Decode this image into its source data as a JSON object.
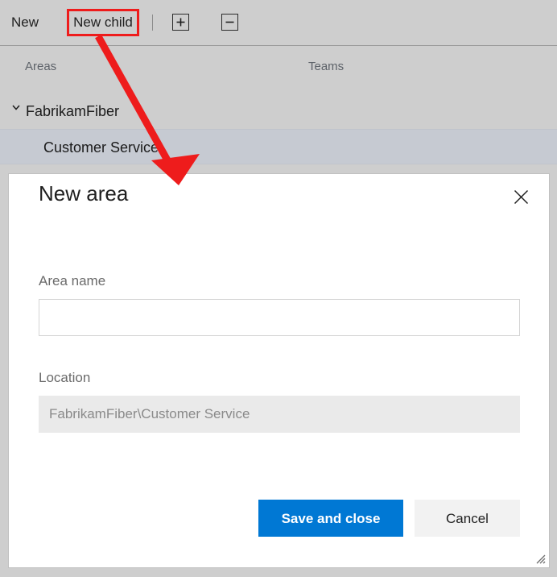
{
  "toolbar": {
    "new_label": "New",
    "new_child_label": "New child",
    "expand_icon": "plus-box-icon",
    "collapse_icon": "minus-box-icon",
    "separator": "|"
  },
  "columns": {
    "areas_label": "Areas",
    "teams_label": "Teams"
  },
  "tree": {
    "rows": [
      {
        "label": "FabrikamFiber",
        "level": 0,
        "expanded": true,
        "selected": false,
        "chevron_icon": "chevron-down-icon"
      },
      {
        "label": "Customer Service",
        "level": 1,
        "expanded": false,
        "selected": true,
        "chevron_icon": ""
      }
    ]
  },
  "dialog": {
    "title": "New area",
    "close_icon": "close-icon",
    "resize_icon": "resize-grip-icon",
    "fields": {
      "area_name": {
        "label": "Area name",
        "value": "",
        "placeholder": ""
      },
      "location": {
        "label": "Location",
        "value": "FabrikamFiber\\Customer Service",
        "readonly": true
      }
    },
    "buttons": {
      "save_label": "Save and close",
      "cancel_label": "Cancel"
    }
  },
  "annotation": {
    "highlight_target": "New child",
    "arrow_color": "#ee1c1c",
    "highlight_box_color": "#ee1c1c"
  },
  "colors": {
    "accent": "#0078d4",
    "page_background": "#cecece",
    "selected_row": "#c6cad2",
    "dialog_background": "#ffffff",
    "readonly_field": "#eaeaea",
    "annotation_red": "#ee1c1c"
  }
}
